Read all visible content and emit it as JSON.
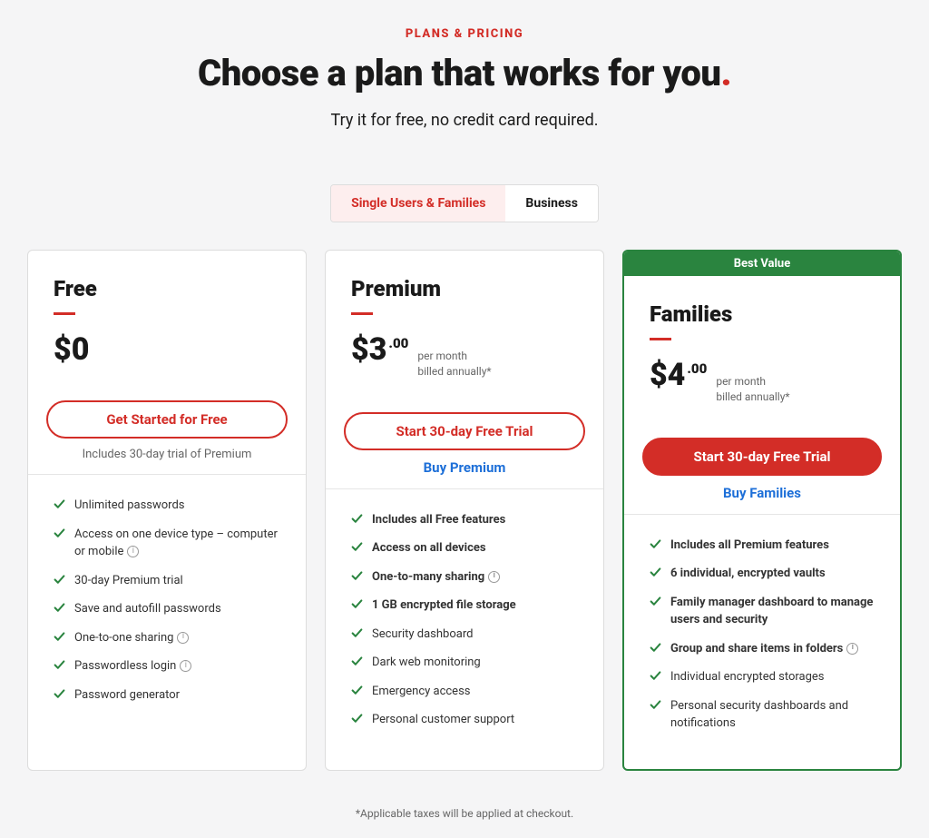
{
  "eyebrow": "PLANS & PRICING",
  "headline": "Choose a plan that works for you",
  "headline_dot": ".",
  "subhead": "Try it for free, no credit card required.",
  "tabs": {
    "a": "Single Users & Families",
    "b": "Business"
  },
  "footnote": "*Applicable taxes will be applied at checkout.",
  "plans": [
    {
      "name": "Free",
      "currency": "$",
      "amount": "0",
      "cents": "",
      "per": "",
      "billed": "",
      "cta": "Get Started for Free",
      "sub_cta": "Includes 30-day trial of Premium",
      "features": [
        {
          "text": "Unlimited passwords",
          "bold": false,
          "info": false
        },
        {
          "text": "Access on one device type – computer or mobile",
          "bold": false,
          "info": true
        },
        {
          "text": "30-day Premium trial",
          "bold": false,
          "info": false
        },
        {
          "text": "Save and autofill passwords",
          "bold": false,
          "info": false
        },
        {
          "text": "One-to-one sharing",
          "bold": false,
          "info": true
        },
        {
          "text": "Passwordless login",
          "bold": false,
          "info": true
        },
        {
          "text": "Password generator",
          "bold": false,
          "info": false
        }
      ]
    },
    {
      "name": "Premium",
      "currency": "$",
      "amount": "3",
      "cents": ".00",
      "per": "per month",
      "billed": "billed annually*",
      "cta": "Start 30-day Free Trial",
      "sub_cta": "Buy Premium",
      "features": [
        {
          "text": "Includes all Free features",
          "bold": true,
          "info": false
        },
        {
          "text": "Access on all devices",
          "bold": true,
          "info": false
        },
        {
          "text": "One-to-many sharing",
          "bold": true,
          "info": true
        },
        {
          "text": "1 GB encrypted file storage",
          "bold": true,
          "info": false
        },
        {
          "text": "Security dashboard",
          "bold": false,
          "info": false
        },
        {
          "text": "Dark web monitoring",
          "bold": false,
          "info": false
        },
        {
          "text": "Emergency access",
          "bold": false,
          "info": false
        },
        {
          "text": "Personal customer support",
          "bold": false,
          "info": false
        }
      ]
    },
    {
      "name": "Families",
      "badge": "Best Value",
      "currency": "$",
      "amount": "4",
      "cents": ".00",
      "per": "per month",
      "billed": "billed annually*",
      "cta": "Start 30-day Free Trial",
      "sub_cta": "Buy Families",
      "features": [
        {
          "text": "Includes all Premium features",
          "bold": true,
          "info": false
        },
        {
          "text": "6 individual, encrypted vaults",
          "bold": true,
          "info": false
        },
        {
          "text": "Family manager dashboard to manage users and security",
          "bold": true,
          "info": false
        },
        {
          "text": "Group and share items in folders",
          "bold": true,
          "info": true
        },
        {
          "text": "Individual encrypted storages",
          "bold": false,
          "info": false
        },
        {
          "text": "Personal security dashboards and notifications",
          "bold": false,
          "info": false
        }
      ]
    }
  ]
}
